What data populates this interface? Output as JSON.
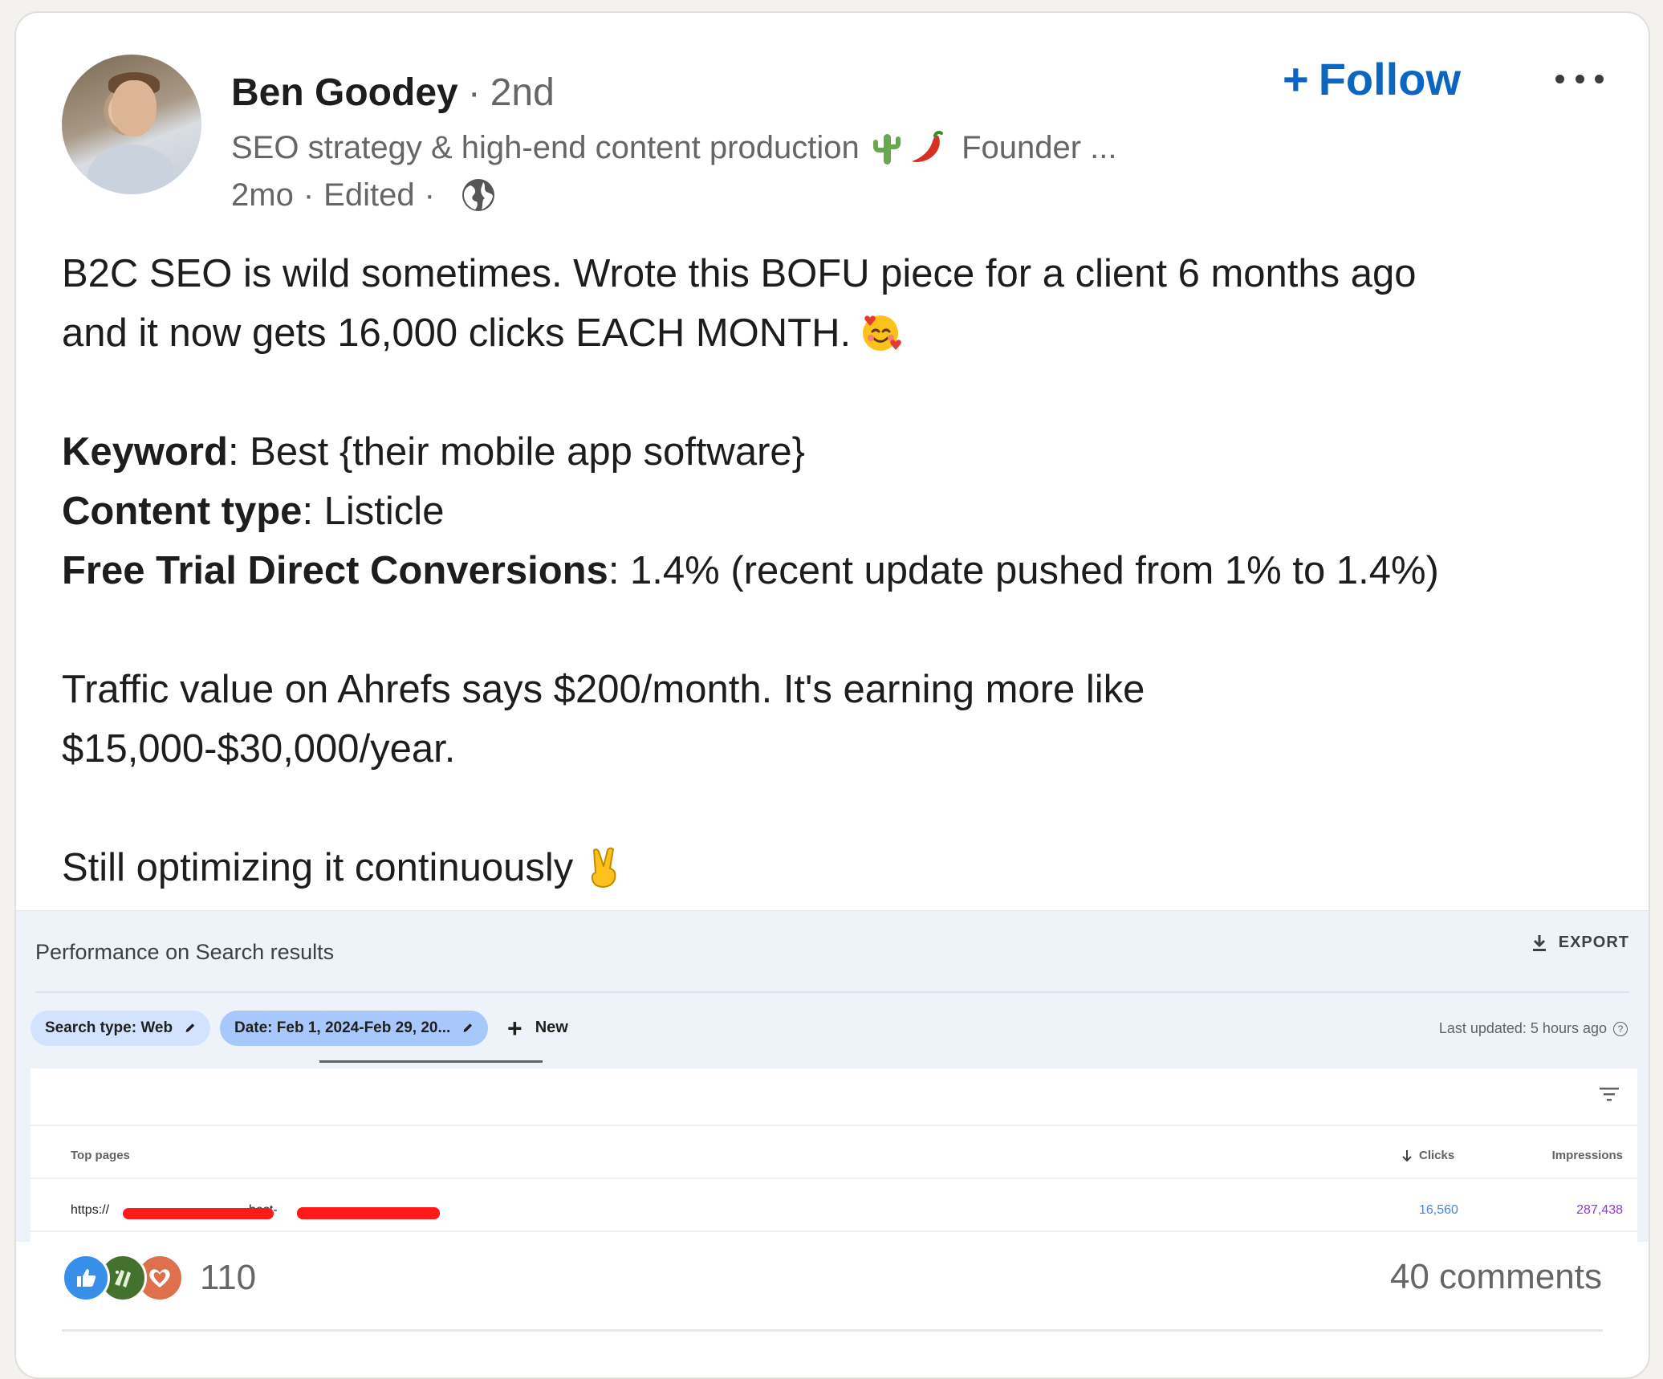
{
  "author": {
    "name": "Ben Goodey",
    "degree": "2nd",
    "headline_prefix": "SEO strategy & high-end content production",
    "headline_suffix": "Founder ...",
    "time": "2mo",
    "edited": "Edited"
  },
  "actions": {
    "follow_label": "Follow",
    "more_icon": "ellipsis-icon"
  },
  "post": {
    "line1": "B2C SEO is wild sometimes. Wrote this BOFU piece for a client 6 months ago",
    "line2": "and it now gets 16,000 clicks EACH MONTH.",
    "keyword_label": "Keyword",
    "keyword_value": ": Best {their mobile app software}",
    "content_type_label": "Content type",
    "content_type_value": ": Listicle",
    "conversions_label": "Free Trial Direct Conversions",
    "conversions_value": ": 1.4% (recent update pushed from 1% to 1.4%)",
    "traffic_line1": "Traffic value on Ahrefs says $200/month. It's earning more like",
    "traffic_line2": "$15,000-$30,000/year.",
    "closing": "Still optimizing it continuously"
  },
  "screenshot": {
    "title": "Performance on Search results",
    "export": "EXPORT",
    "chip_search_type": "Search type: Web",
    "chip_date": "Date: Feb 1, 2024-Feb 29, 20...",
    "new_label": "New",
    "last_updated": "Last updated: 5 hours ago",
    "columns": {
      "pages": "Top pages",
      "clicks": "Clicks",
      "impressions": "Impressions"
    },
    "row": {
      "url_start": "https://",
      "url_mid": "best-",
      "clicks": "16,560",
      "impressions": "287,438"
    }
  },
  "footer": {
    "reaction_count": "110",
    "comments": "40 comments"
  },
  "colors": {
    "link_blue": "#0a66c2",
    "clicks_blue": "#4285f4",
    "impressions_purple": "#9334e6",
    "redaction_red": "#ff1a1a"
  }
}
